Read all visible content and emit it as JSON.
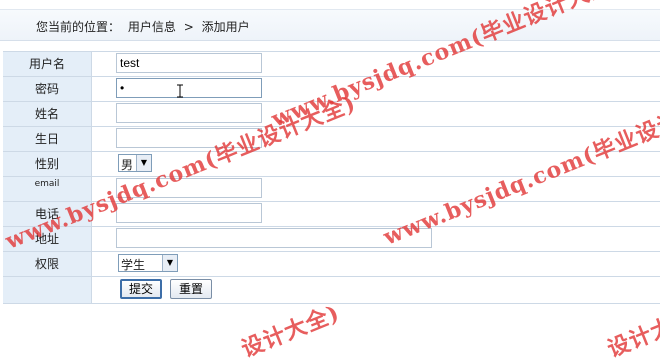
{
  "breadcrumb": {
    "prefix": "您当前的位置：",
    "parent": "用户信息",
    "separator": ">",
    "current": "添加用户"
  },
  "form": {
    "fields": {
      "username": {
        "label": "用户名",
        "value": "test"
      },
      "password": {
        "label": "密码",
        "value": "•"
      },
      "name": {
        "label": "姓名",
        "value": ""
      },
      "birthday": {
        "label": "生日",
        "value": ""
      },
      "gender": {
        "label": "性别",
        "value": "男"
      },
      "email": {
        "label": "email",
        "value": ""
      },
      "phone": {
        "label": "电话",
        "value": ""
      },
      "address": {
        "label": "地址",
        "value": ""
      },
      "permission": {
        "label": "权限",
        "value": "学生"
      }
    },
    "buttons": {
      "submit": "提交",
      "reset": "重置"
    }
  },
  "watermarks": [
    "www.bysjdq.com(毕业设计大全)",
    "www.bysjdq.com(毕业设计",
    "设计大全)",
    "设计大"
  ],
  "colors": {
    "label_bg": "#e4eef8",
    "border": "#cdd9e6",
    "watermark": "#e23a3a"
  }
}
